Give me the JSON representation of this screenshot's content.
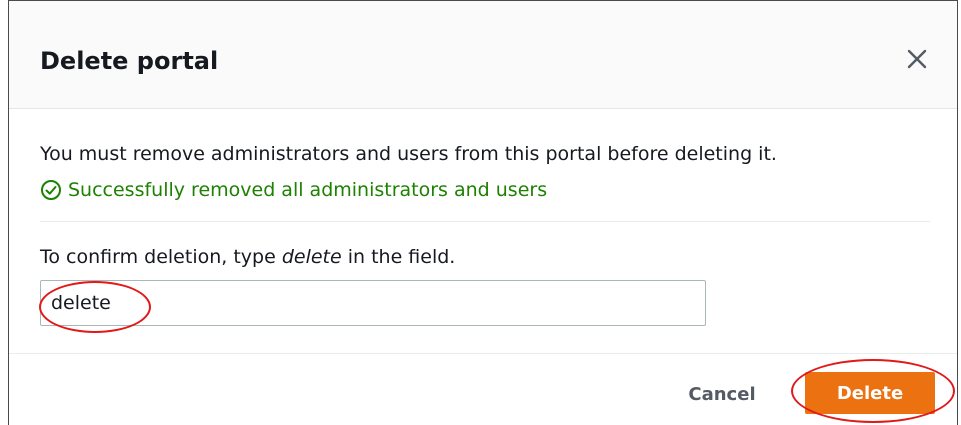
{
  "modal": {
    "title": "Delete portal",
    "close_icon": "close-icon",
    "message": "You must remove administrators and users from this portal before deleting it.",
    "success": {
      "icon": "check-circle-icon",
      "text": "Successfully removed all administrators and users",
      "color": "#1d8102"
    },
    "confirm": {
      "label_prefix": "To confirm deletion, type ",
      "label_keyword": "delete",
      "label_suffix": " in the field.",
      "input_value": "delete"
    },
    "footer": {
      "cancel_label": "Cancel",
      "delete_label": "Delete",
      "delete_color": "#ec7211"
    },
    "annotation_color": "#e11919"
  }
}
